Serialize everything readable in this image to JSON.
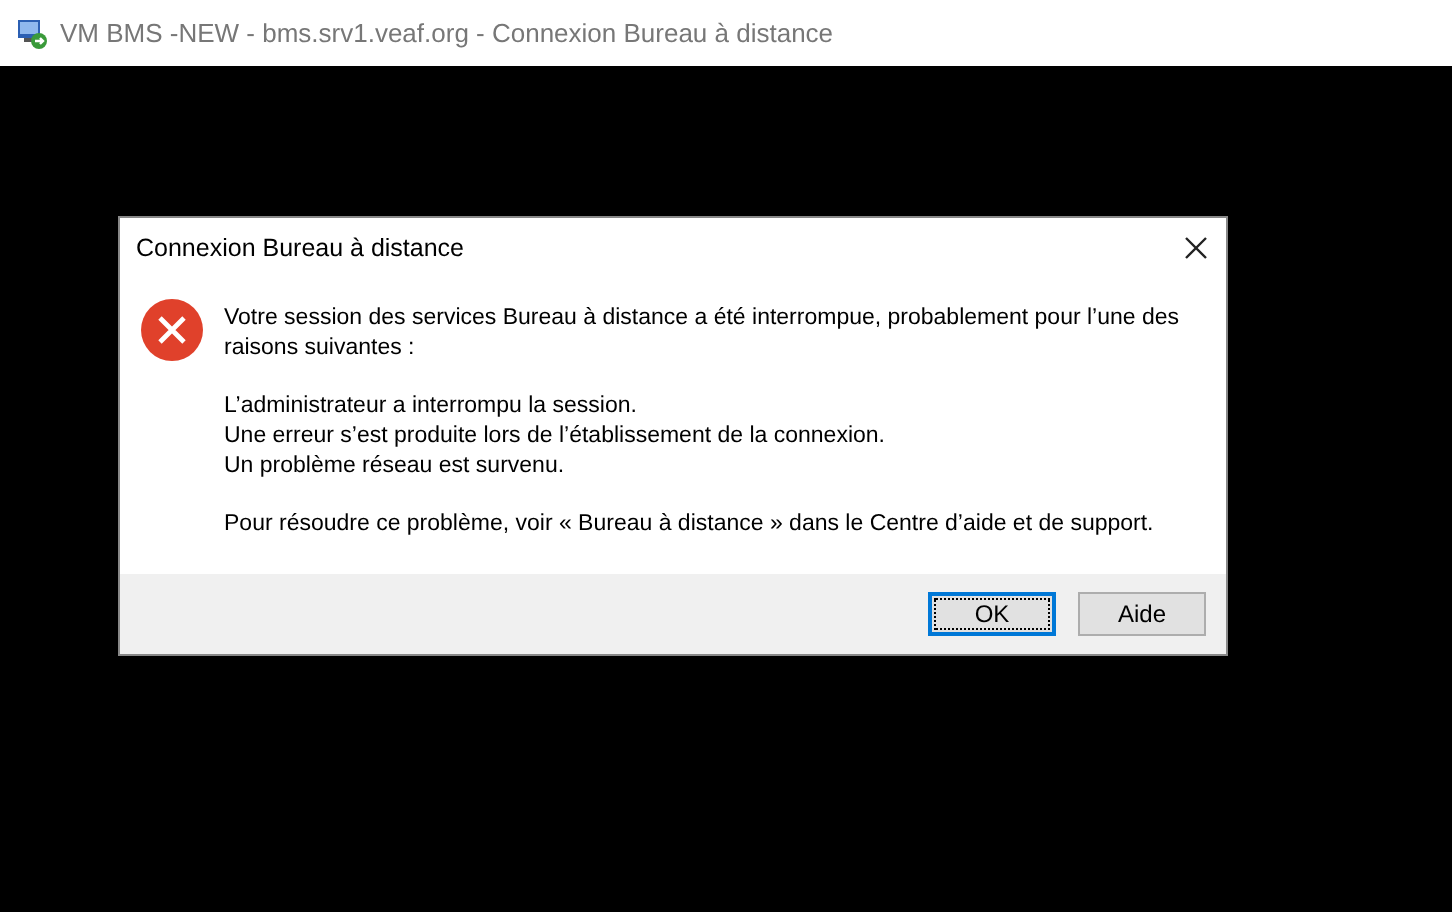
{
  "window": {
    "title": "VM BMS -NEW - bms.srv1.veaf.org - Connexion Bureau à distance"
  },
  "dialog": {
    "title": "Connexion Bureau à distance",
    "message": "Votre session des services Bureau à distance a été interrompue, probablement pour l’une des raisons suivantes :",
    "reasons": [
      "L’administrateur a interrompu la session.",
      "Une erreur s’est produite lors de l’établissement de la connexion.",
      "Un problème réseau est survenu."
    ],
    "help": "Pour résoudre ce problème, voir « Bureau à distance » dans le Centre d’aide et de support.",
    "buttons": [
      {
        "label": "OK",
        "default": true
      },
      {
        "label": "Aide",
        "default": false
      }
    ]
  }
}
